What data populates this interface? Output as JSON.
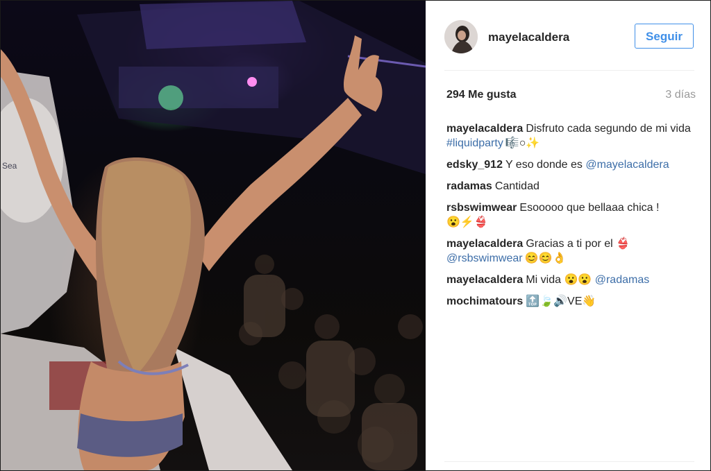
{
  "post": {
    "photo_alt": "",
    "username": "mayelacaldera",
    "follow_label": "Seguir",
    "likes": "294 Me gusta",
    "age": "3 días",
    "colors": {
      "accent": "#3f8fe8",
      "link": "#3d6ea8",
      "text": "#262626",
      "muted": "#999999"
    }
  },
  "comments": [
    {
      "user": "mayelacaldera",
      "text": "Disfruto cada segundo de mi vida ",
      "link": "#liquidparty",
      "emoji": "🎼○✨"
    },
    {
      "user": "edsky_912",
      "text": "Y eso donde es ",
      "link": "@mayelacaldera",
      "emoji": ""
    },
    {
      "user": "radamas",
      "text": "Cantidad",
      "link": "",
      "emoji": ""
    },
    {
      "user": "rsbswimwear",
      "text": "Esooooo que bellaaa chica !",
      "link": "",
      "emoji": "😮⚡👙"
    },
    {
      "user": "mayelacaldera",
      "text": "Gracias a ti por el 👙 ",
      "link": "@rsbswimwear",
      "emoji": "😊😊👌"
    },
    {
      "user": "mayelacaldera",
      "text": "Mi vida 😮😮 ",
      "link": "@radamas",
      "emoji": ""
    },
    {
      "user": "mochimatours",
      "text": "",
      "link": "",
      "emoji": "🔝🍃🔊VE👋"
    }
  ]
}
